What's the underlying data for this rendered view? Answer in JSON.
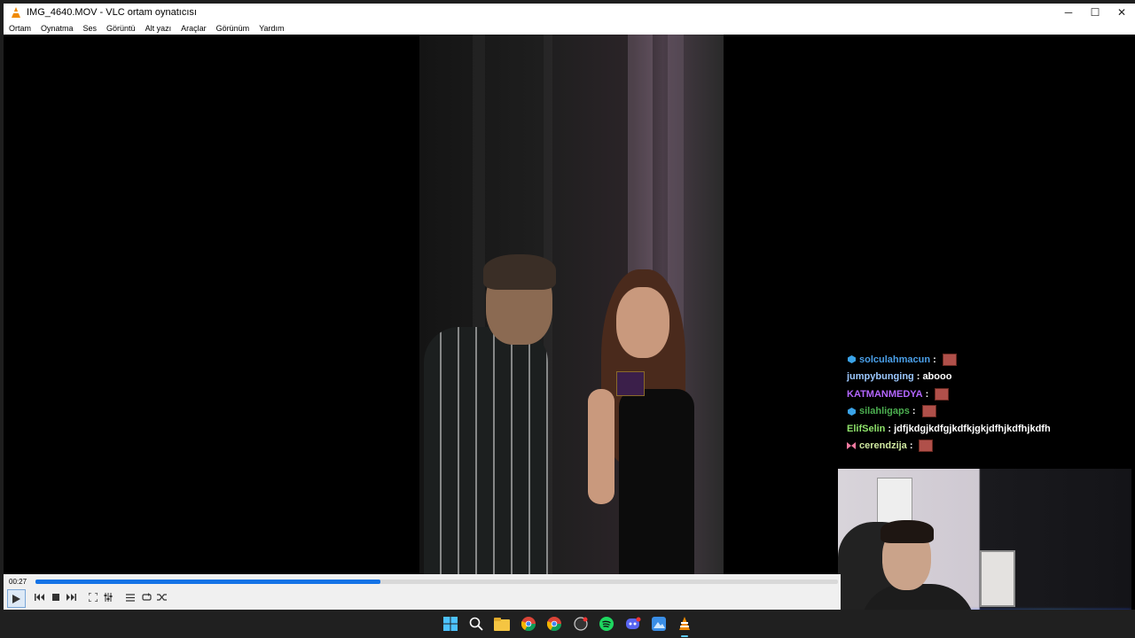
{
  "window": {
    "title": "IMG_4640.MOV - VLC ortam oynatıcısı",
    "controls": {
      "minimize": "─",
      "maximize": "☐",
      "close": "✕"
    }
  },
  "menu": [
    "Ortam",
    "Oynatma",
    "Ses",
    "Görüntü",
    "Alt yazı",
    "Araçlar",
    "Görünüm",
    "Yardım"
  ],
  "chat": [
    {
      "user": "solculahmacun",
      "color": "#4a9fe8",
      "badge": "cube",
      "text": "",
      "emote": true
    },
    {
      "user": "jumpybunging",
      "color": "#9cc8ff",
      "badge": "",
      "text": "abooo",
      "emote": false
    },
    {
      "user": "KATMANMEDYA",
      "color": "#b366ff",
      "badge": "",
      "text": "",
      "emote": true
    },
    {
      "user": "silahligaps",
      "color": "#4caf50",
      "badge": "cube",
      "text": "",
      "emote": true
    },
    {
      "user": "ElifSelin",
      "color": "#8fe36b",
      "badge": "",
      "text": "jdfjkdgjkdfgjkdfkjgkjdfhjkdfhjkdfh",
      "emote": false
    },
    {
      "user": "cerendzija",
      "color": "#cfe7a0",
      "badge": "bow",
      "text": "",
      "emote": true
    }
  ],
  "chat_separator": ":",
  "player": {
    "elapsed": "00:27",
    "progress": 0.43,
    "accent": "#1473e6"
  },
  "taskbar_icons": [
    "windows-start-icon",
    "search-icon",
    "file-explorer-icon",
    "chrome-icon",
    "chrome-profile-icon",
    "github-icon",
    "spotify-icon",
    "discord-icon",
    "photos-icon",
    "vlc-icon"
  ]
}
